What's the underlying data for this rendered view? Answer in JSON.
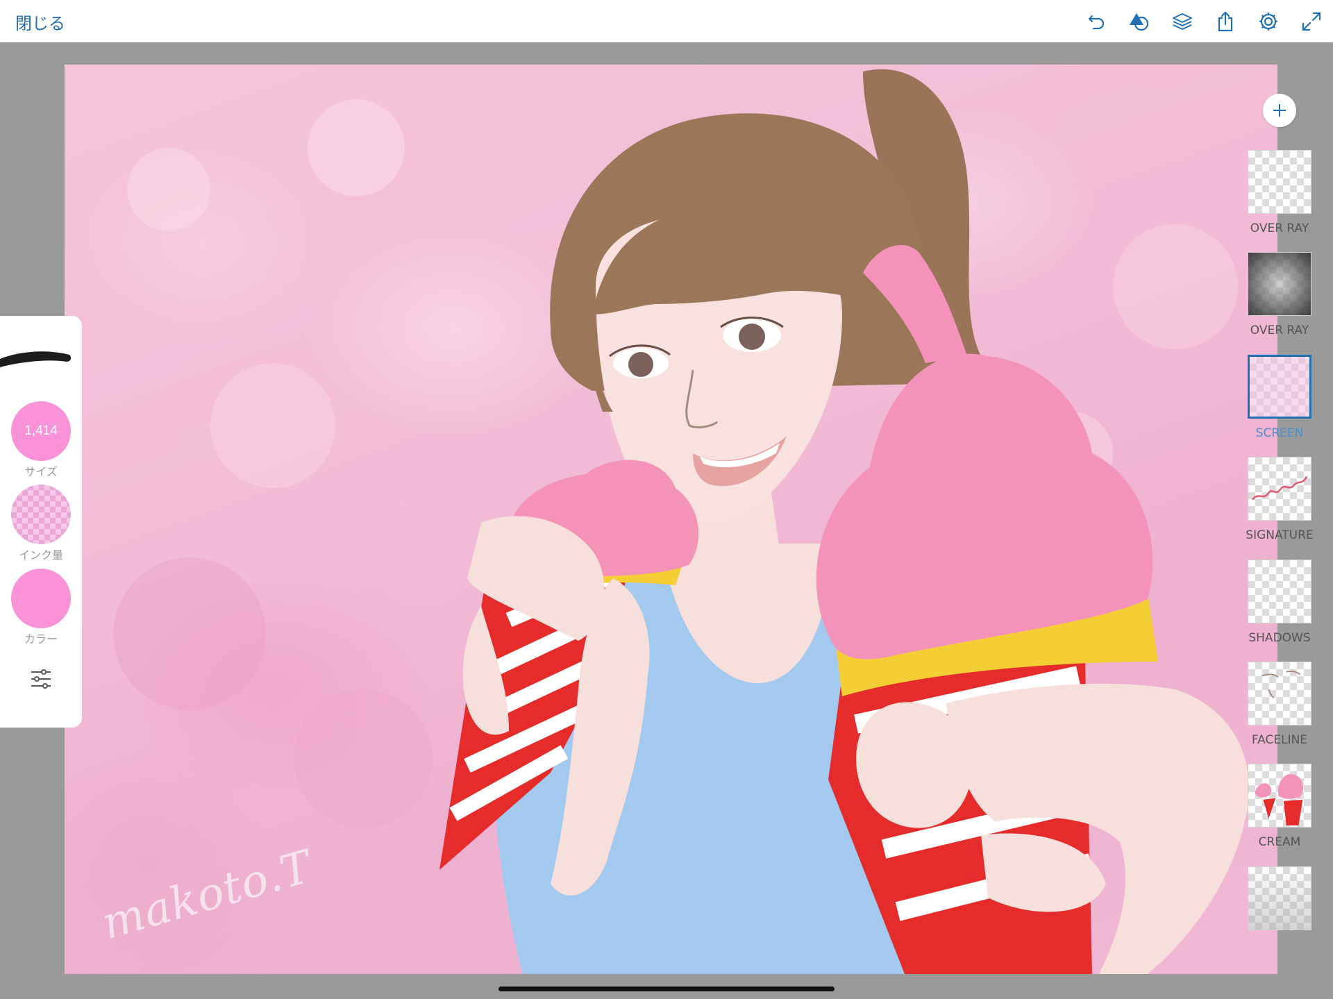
{
  "topbar": {
    "close_label": "閉じる",
    "icons": [
      "undo-icon",
      "shape-tools-icon",
      "layers-icon",
      "share-icon",
      "settings-icon",
      "fullscreen-icon"
    ]
  },
  "brush_panel": {
    "size_value": "1,414",
    "size_label": "サイズ",
    "ink_label": "インク量",
    "color_label": "カラー",
    "brush_color": "#f992d6"
  },
  "layers": [
    {
      "name": "OVER RAY",
      "active": false
    },
    {
      "name": "OVER RAY",
      "active": false
    },
    {
      "name": "SCREEN",
      "active": true
    },
    {
      "name": "SIGNATURE",
      "active": false
    },
    {
      "name": "SHADOWS",
      "active": false
    },
    {
      "name": "FACELINE",
      "active": false
    },
    {
      "name": "CREAM",
      "active": false
    },
    {
      "name": "",
      "active": false
    }
  ],
  "canvas": {
    "signature_text": "makoto.T"
  },
  "colors": {
    "accent": "#1f6fb5",
    "background": "#9a9a9a",
    "panel": "#ffffff"
  }
}
